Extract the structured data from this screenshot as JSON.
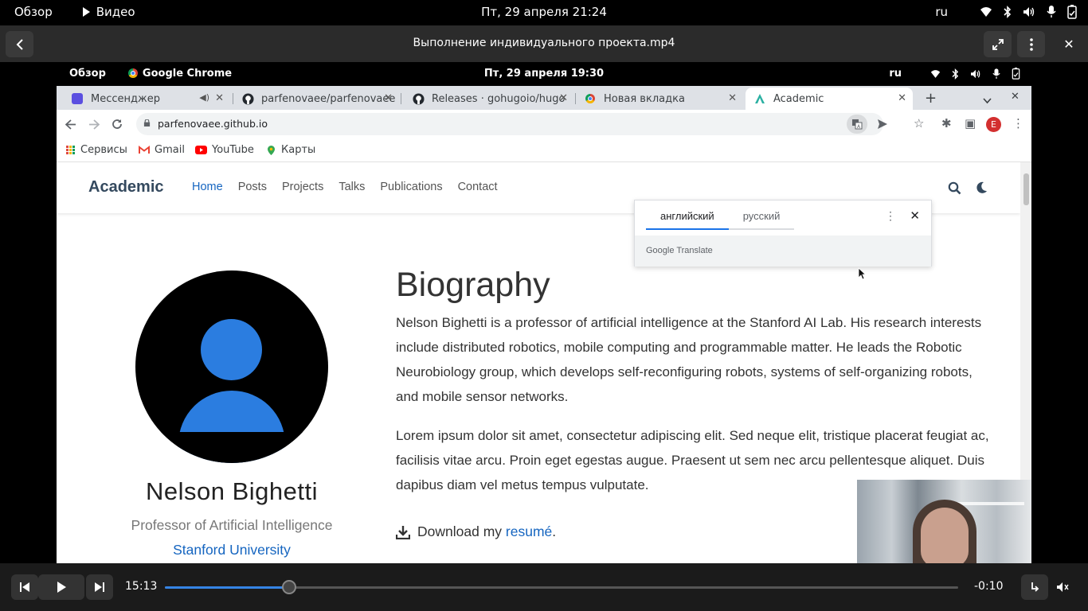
{
  "host_bar": {
    "overview": "Обзор",
    "app": "Видео",
    "clock": "Пт, 29 апреля  21:24",
    "lang": "ru"
  },
  "player": {
    "title": "Выполнение индивидуального проекта.mp4",
    "current_time": "15:13",
    "remaining_time": "-0:10",
    "progress": 0.157
  },
  "guest_bar": {
    "overview": "Обзор",
    "app": "Google Chrome",
    "clock": "Пт, 29 апреля  19:30",
    "lang": "ru"
  },
  "browser": {
    "tabs": [
      {
        "label": "Мессенджер",
        "icon": "messenger-icon"
      },
      {
        "label": "parfenovaee/parfenovaee",
        "icon": "github-icon"
      },
      {
        "label": "Releases · gohugoio/hugo",
        "icon": "github-icon"
      },
      {
        "label": "Новая вкладка",
        "icon": "chrome-icon"
      },
      {
        "label": "Academic",
        "icon": "academic-icon"
      }
    ],
    "url": "parfenovaee.github.io",
    "avatar_letter": "E",
    "bookmarks": [
      "Сервисы",
      "Gmail",
      "YouTube",
      "Карты"
    ]
  },
  "translate_popup": {
    "source_lang": "английский",
    "target_lang": "русский",
    "footer": "Google Translate"
  },
  "site": {
    "brand": "Academic",
    "menu": [
      "Home",
      "Posts",
      "Projects",
      "Talks",
      "Publications",
      "Contact"
    ],
    "active_menu": "Home",
    "profile": {
      "name": "Nelson Bighetti",
      "role": "Professor of Artificial Intelligence",
      "org": "Stanford University"
    },
    "bio_title": "Biography",
    "bio_para1": "Nelson Bighetti is a professor of artificial intelligence at the Stanford AI Lab. His research interests include distributed robotics, mobile computing and programmable matter. He leads the Robotic Neurobiology group, which develops self-reconfiguring robots, systems of self-organizing robots, and mobile sensor networks.",
    "bio_para2": "Lorem ipsum dolor sit amet, consectetur adipiscing elit. Sed neque elit, tristique placerat feugiat ac, facilisis vitae arcu. Proin eget egestas augue. Praesent ut sem nec arcu pellentesque aliquet. Duis dapibus diam vel metus tempus vulputate.",
    "download_prefix": "Download my",
    "download_link": "resumé",
    "download_suffix": "."
  },
  "colors": {
    "accent": "#1565c0",
    "avatar_blue": "#2b7de0",
    "player_accent": "#3584e4"
  }
}
